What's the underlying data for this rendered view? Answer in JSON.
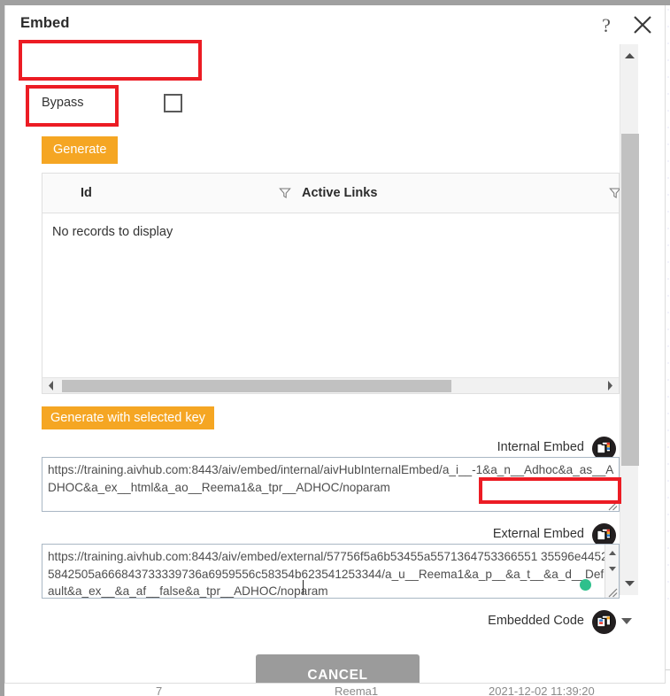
{
  "dialog": {
    "title": "Embed",
    "help_label": "?",
    "close_label": "close-icon"
  },
  "bypass": {
    "label": "Bypass",
    "checked": false
  },
  "buttons": {
    "generate": "Generate",
    "generate_with_selected_key": "Generate with selected key",
    "cancel": "CANCEL"
  },
  "grid": {
    "columns": [
      "Id",
      "Active Links"
    ],
    "empty_message": "No records to display"
  },
  "internal_embed": {
    "label": "Internal Embed",
    "value": "https://training.aivhub.com:8443/aiv/embed/internal/aivHubInternalEmbed/a_i__-1&a_n__Adhoc&a_as__ADHOC&a_ex__html&a_ao__Reema1&a_tpr__ADHOC/noparam"
  },
  "external_embed": {
    "label": "External Embed",
    "value": "https://training.aivhub.com:8443/aiv/embed/external/57756f5a6b53455a5571364753366551 35596e44525842505a666843733339736a6959556c58354b623541253344/a_u__Reema1&a_p__&a_t__&a_d__Default&a_ex__&a_af__false&a_tpr__ADHOC/noparam"
  },
  "embedded_code": {
    "label": "Embedded Code"
  },
  "background_row": {
    "number": "7",
    "user": "Reema1",
    "datetime": "2021-12-02 11:39:20"
  },
  "colors": {
    "accent_orange": "#f5a623",
    "annotation_red": "#ec1c24",
    "cancel_gray": "#9b9b9b",
    "cursor_green": "#2ec08c"
  }
}
